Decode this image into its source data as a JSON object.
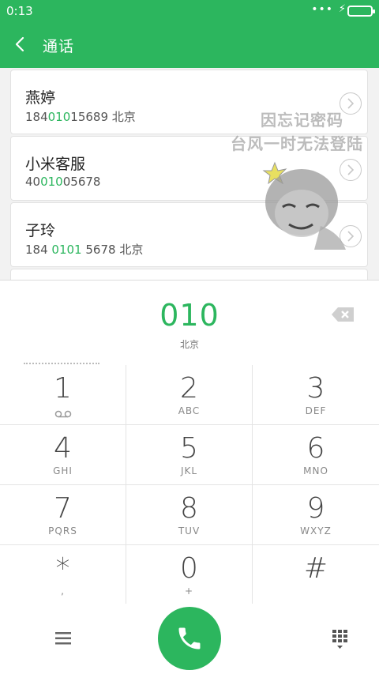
{
  "status_bar": {
    "time": "0:13",
    "dots": "•••"
  },
  "header": {
    "title": "通话"
  },
  "contacts": [
    {
      "name": "燕婷",
      "number_pre": "184",
      "number_hl": "010",
      "number_post": "15689",
      "location": "北京"
    },
    {
      "name": "小米客服",
      "number_pre": "40",
      "number_hl": "010",
      "number_post": "05678",
      "location": ""
    },
    {
      "name": "子玲",
      "number_pre": "184 ",
      "number_hl": "0101",
      "number_post": " 5678",
      "location": "北京"
    }
  ],
  "watermark": {
    "line1": "因忘记密码",
    "line2": "台风一时无法登陆"
  },
  "dialer": {
    "dialed_number": "010",
    "location": "北京",
    "keys": [
      {
        "digit": "1",
        "letters": ""
      },
      {
        "digit": "2",
        "letters": "ABC"
      },
      {
        "digit": "3",
        "letters": "DEF"
      },
      {
        "digit": "4",
        "letters": "GHI"
      },
      {
        "digit": "5",
        "letters": "JKL"
      },
      {
        "digit": "6",
        "letters": "MNO"
      },
      {
        "digit": "7",
        "letters": "PQRS"
      },
      {
        "digit": "8",
        "letters": "TUV"
      },
      {
        "digit": "9",
        "letters": "WXYZ"
      },
      {
        "digit": "*",
        "letters": ","
      },
      {
        "digit": "0",
        "letters": "+"
      },
      {
        "digit": "#",
        "letters": ""
      }
    ]
  },
  "colors": {
    "accent": "#2cb65e",
    "text": "#222222",
    "muted": "#888888"
  },
  "icons": {
    "back": "chevron-left-icon",
    "contact_detail": "chevron-right-circle-icon",
    "delete": "backspace-icon",
    "voicemail": "voicemail-icon",
    "menu": "menu-icon",
    "call": "phone-icon",
    "keypad_toggle": "dialpad-icon"
  }
}
